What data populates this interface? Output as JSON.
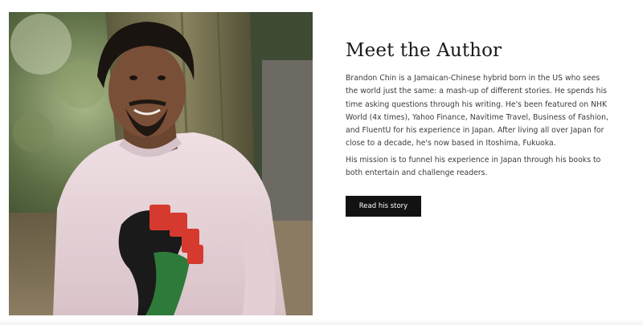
{
  "author": {
    "photo_icon": "author-portrait-photo",
    "title": "Meet the Author",
    "bio_1": "Brandon Chin is a Jamaican-Chinese hybrid born in the US who sees the world just the same: a mash-up of different stories. He spends his time asking questions through his writing. He's been featured on NHK World (4x times), Yahoo Finance, Navitime Travel, Business of Fashion, and FluentU for his experience in Japan. After living all over Japan for close to a decade, he's now based in Itoshima, Fukuoka.",
    "bio_2": "His mission is to funnel his experience in Japan through his books to both entertain and challenge readers.",
    "cta_label": "Read his story"
  },
  "colors": {
    "button_bg": "#121212",
    "button_text": "#ffffff",
    "title_text": "#1a1a1a",
    "body_text": "#3b3b3b"
  }
}
